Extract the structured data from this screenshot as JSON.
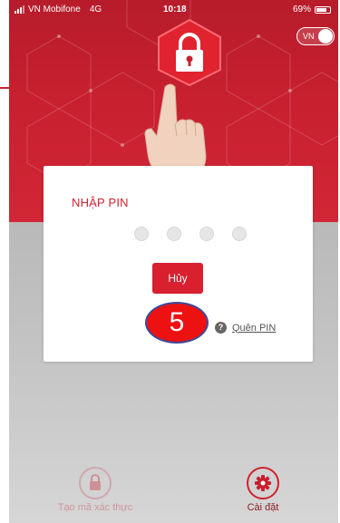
{
  "status_bar": {
    "carrier": "VN Mobifone",
    "network": "4G",
    "time": "10:18",
    "battery": "69%"
  },
  "language_toggle": {
    "label": "VN"
  },
  "dialog": {
    "title": "NHẬP PIN",
    "pin_length": 4,
    "cancel_label": "Hủy",
    "step_badge": "5",
    "forgot_icon": "?",
    "forgot_label": "Quên PIN"
  },
  "bottom_nav": {
    "items": [
      {
        "label": "Tạo mã xác thực",
        "icon": "lock-icon"
      },
      {
        "label": "Cài đặt",
        "icon": "gear-icon"
      }
    ]
  },
  "colors": {
    "brand_red": "#d0212f",
    "badge_red": "#ee1111",
    "badge_border": "#3b4a9a"
  }
}
